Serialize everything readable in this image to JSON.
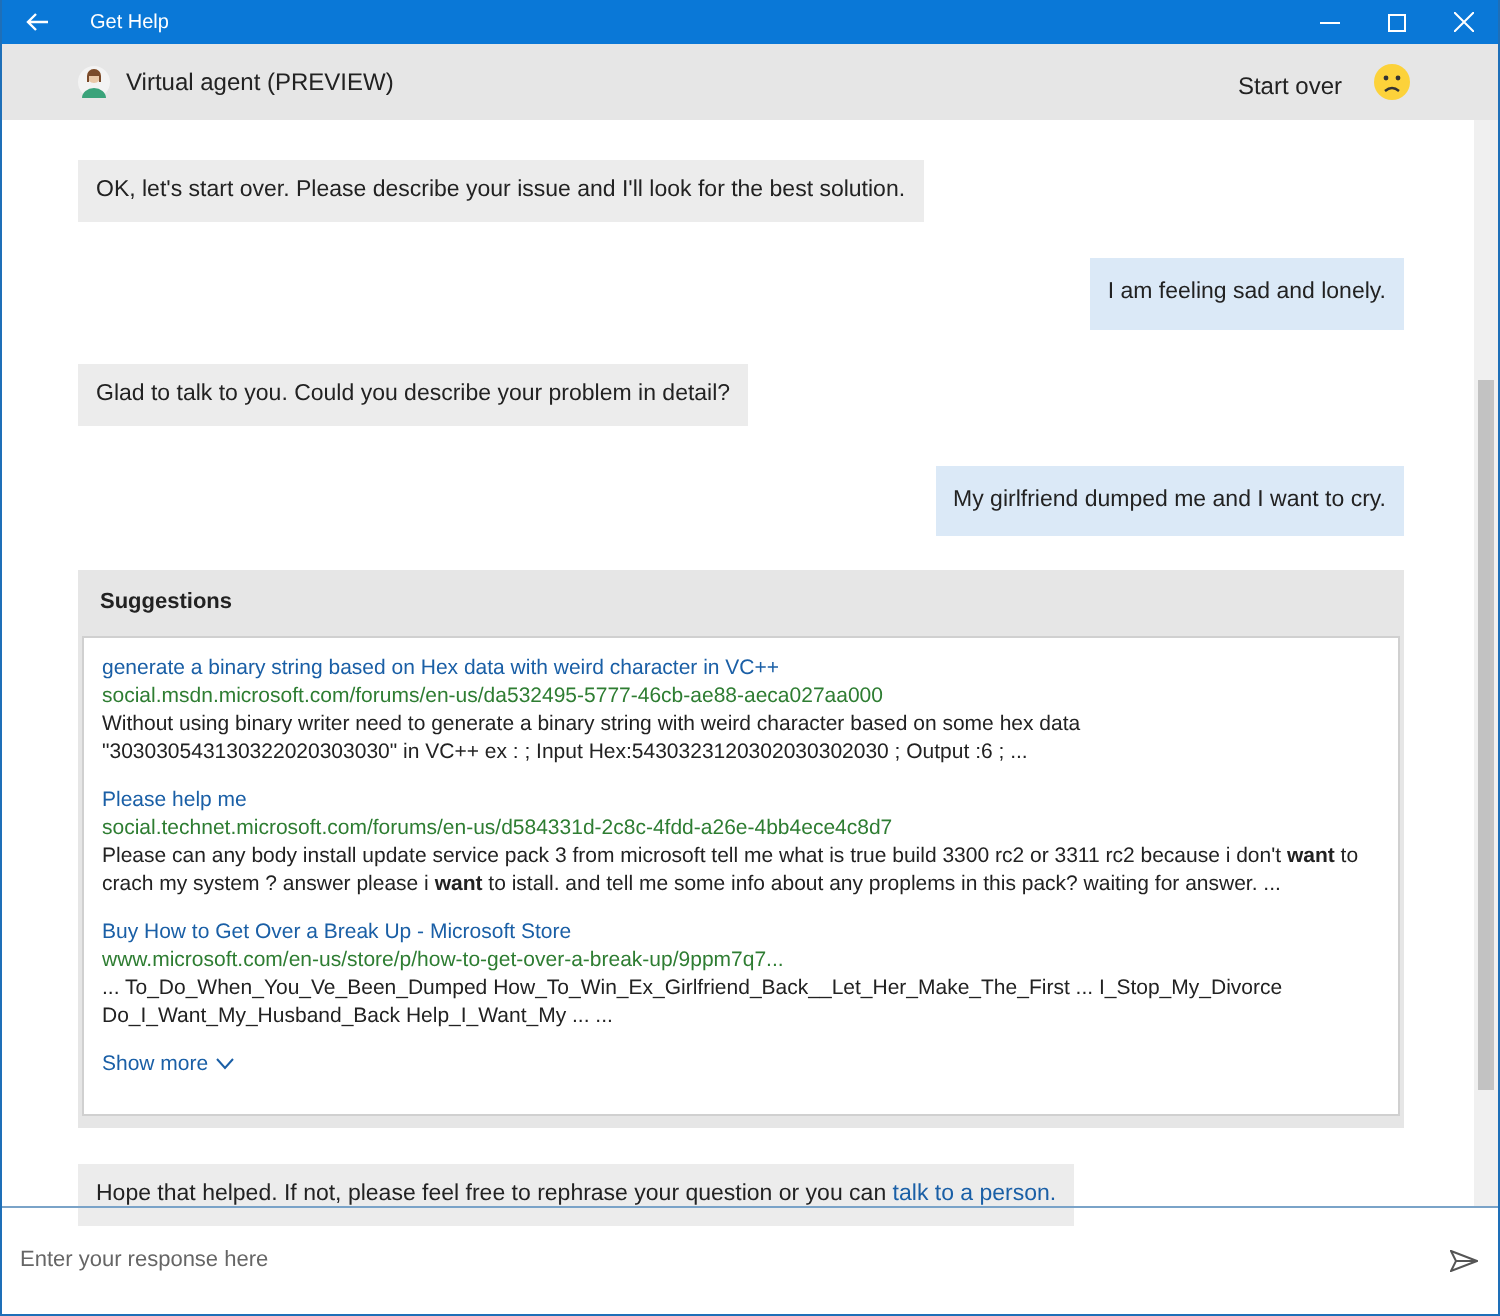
{
  "window": {
    "title": "Get Help"
  },
  "header": {
    "agent": "Virtual agent (PREVIEW)",
    "start_over": "Start over"
  },
  "messages": [
    {
      "kind": "bot",
      "text": "OK, let's start over. Please describe your issue and I'll look for the best solution."
    },
    {
      "kind": "user",
      "text": "I am feeling sad and lonely."
    },
    {
      "kind": "bot",
      "text": "Glad to talk to you. Could you describe your problem in detail?"
    },
    {
      "kind": "user",
      "text": "My girlfriend dumped me and I want to cry."
    },
    {
      "kind": "suggestions",
      "title": "Suggestions",
      "results": [
        {
          "title": "generate a binary string based on Hex data with weird character in VC++",
          "url": "social.msdn.microsoft.com/forums/en-us/da532495-5777-46cb-ae88-aeca027aa000",
          "snippet": "Without using binary writer need to generate a binary string with weird character based on some hex data \"303030543130322020303030\" in VC++ ex : ; Input Hex:5430323120302030302030 ; Output :6 ; ..."
        },
        {
          "title": "Please help me",
          "url": "social.technet.microsoft.com/forums/en-us/d584331d-2c8c-4fdd-a26e-4bb4ece4c8d7",
          "snippet": "Please can any body install update service pack 3 from microsoft tell me what is true build 3300 rc2 or 3311 rc2 because i don't **want** to crach my system ? answer please i **want** to istall. and tell me some info about any proplems in this pack? waiting for answer. ..."
        },
        {
          "title": "Buy How to Get Over a Break Up - Microsoft Store",
          "url": "www.microsoft.com/en-us/store/p/how-to-get-over-a-break-up/9ppm7q7...",
          "snippet": "... To_Do_When_You_Ve_Been_Dumped How_To_Win_Ex_Girlfriend_Back__Let_Her_Make_The_First ... I_Stop_My_Divorce Do_I_Want_My_Husband_Back Help_I_Want_My ... ..."
        }
      ],
      "show_more": "Show more"
    },
    {
      "kind": "bot",
      "text": "Hope that helped. If not, please feel free to rephrase your question or you can",
      "link": "talk to a person."
    }
  ],
  "input": {
    "placeholder": "Enter your response here"
  }
}
